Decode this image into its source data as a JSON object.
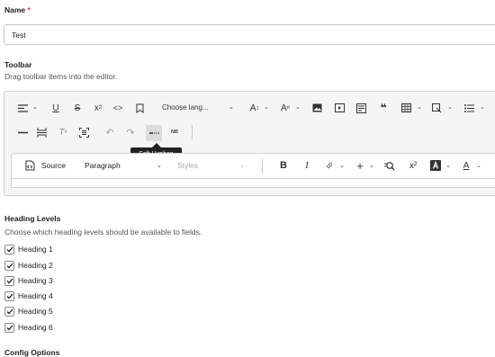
{
  "name_field": {
    "label": "Name",
    "required_mark": "*",
    "value": "Test"
  },
  "toolbar_section": {
    "title": "Toolbar",
    "description": "Drag toolbar items into the editor.",
    "language_select": "Choose lang...",
    "nbsp_label": "NB",
    "tooltip": "Soft Hyphen"
  },
  "editor": {
    "source_label": "Source",
    "format_select": "Paragraph",
    "styles_select": "Styles",
    "bold_glyph": "B",
    "italic_glyph": "I",
    "superscript_glyph": "x²"
  },
  "heading_levels": {
    "title": "Heading Levels",
    "description": "Choose which heading levels should be available to fields.",
    "items": [
      {
        "label": "Heading 1",
        "checked": true
      },
      {
        "label": "Heading 2",
        "checked": true
      },
      {
        "label": "Heading 3",
        "checked": true
      },
      {
        "label": "Heading 4",
        "checked": true
      },
      {
        "label": "Heading 5",
        "checked": true
      },
      {
        "label": "Heading 6",
        "checked": true
      }
    ]
  },
  "config_options": {
    "title": "Config Options"
  },
  "colors": {
    "required": "#e0245e",
    "tooltip_bg": "#222222",
    "panel_bg": "#f5f5f5"
  }
}
